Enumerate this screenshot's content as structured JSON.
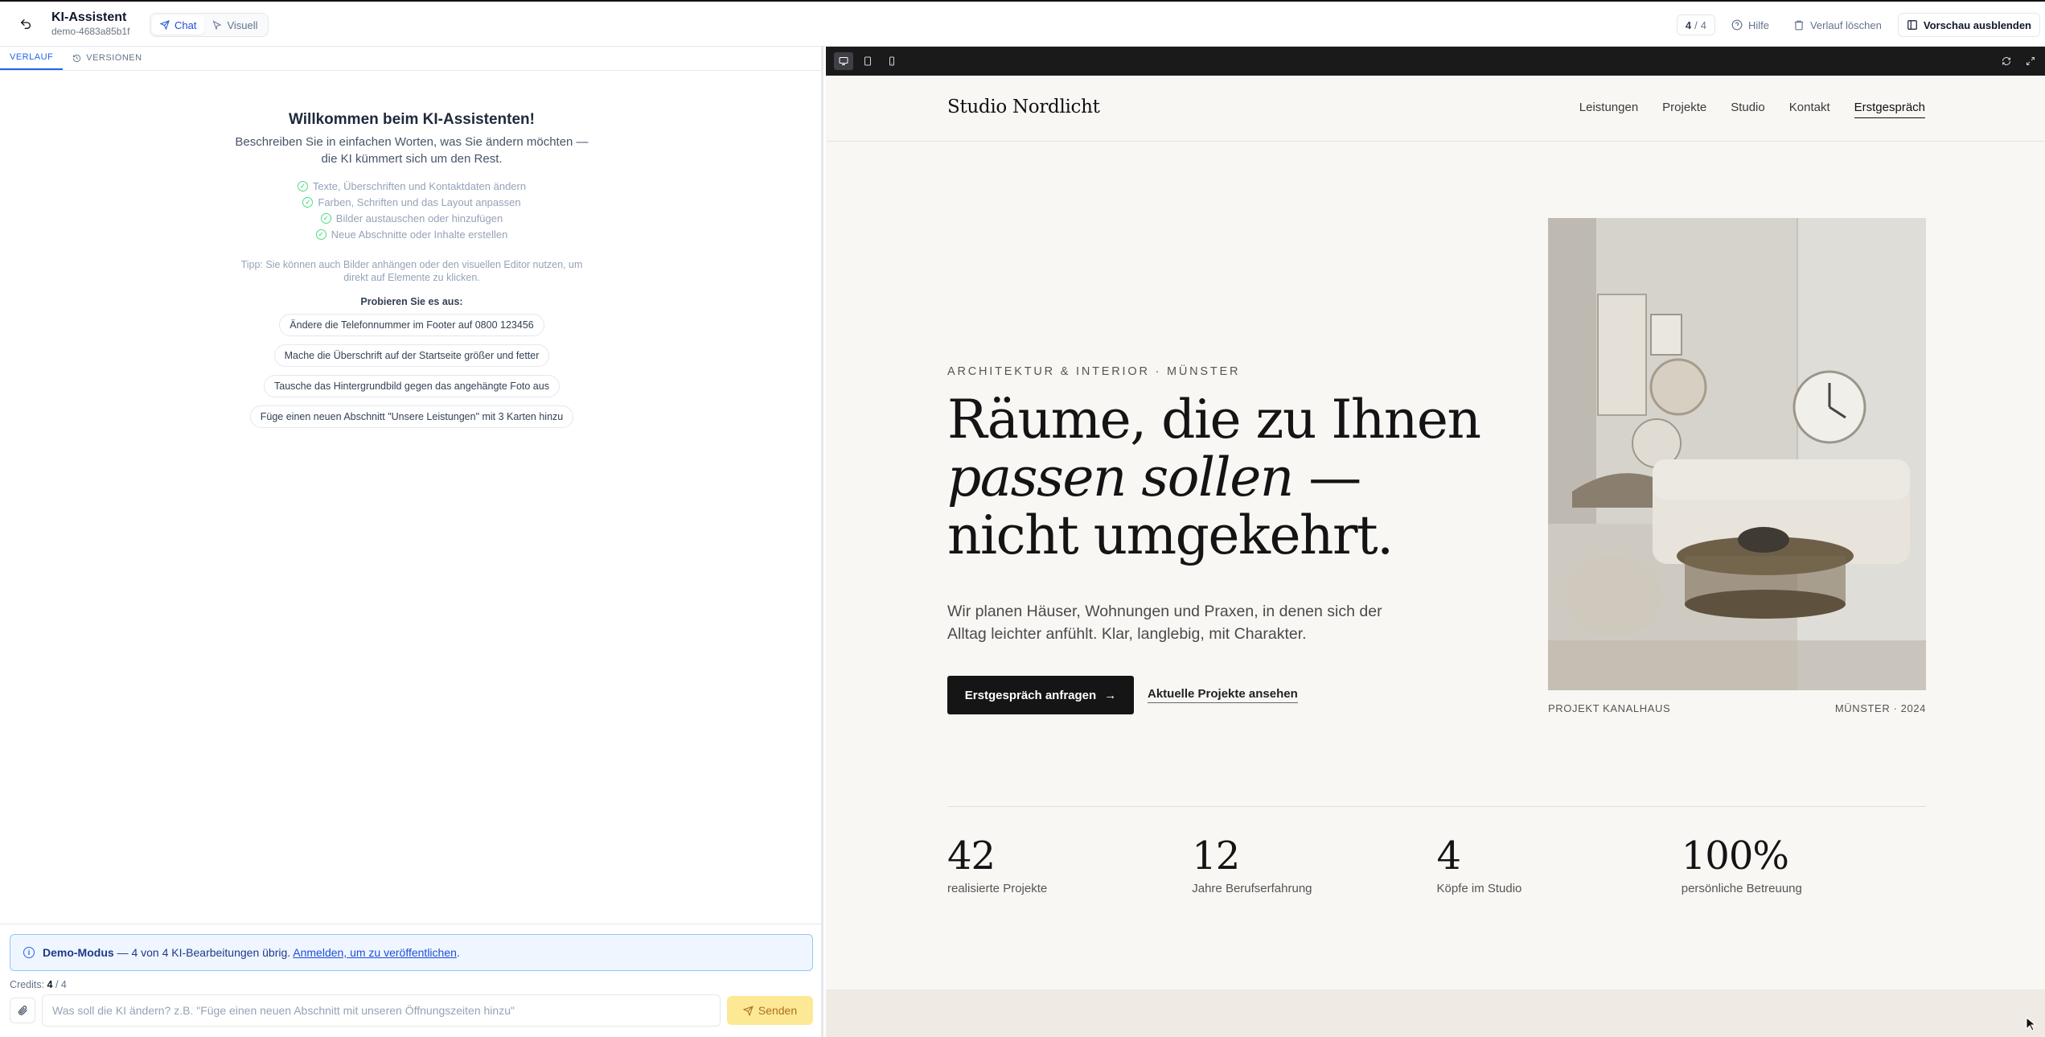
{
  "topbar": {
    "title": "KI-Assistent",
    "subtitle": "demo-4683a85b1f",
    "modes": [
      {
        "label": "Chat",
        "icon": "send-icon",
        "active": true
      },
      {
        "label": "Visuell",
        "icon": "cursor-icon",
        "active": false
      }
    ],
    "credits": {
      "used": "4",
      "sep": "/",
      "total": "4"
    },
    "help_label": "Hilfe",
    "clear_label": "Verlauf löschen",
    "hide_preview_label": "Vorschau ausblenden"
  },
  "left": {
    "tabs": [
      {
        "label": "VERLAUF",
        "active": true
      },
      {
        "label": "VERSIONEN",
        "icon": "history-icon",
        "active": false
      }
    ],
    "welcome": {
      "title": "Willkommen beim KI-Assistenten!",
      "lead": "Beschreiben Sie in einfachen Worten, was Sie ändern möchten — die KI kümmert sich um den Rest.",
      "features": [
        "Texte, Überschriften und Kontaktdaten ändern",
        "Farben, Schriften und das Layout anpassen",
        "Bilder austauschen oder hinzufügen",
        "Neue Abschnitte oder Inhalte erstellen"
      ],
      "tip": "Tipp: Sie können auch Bilder anhängen oder den visuellen Editor nutzen, um direkt auf Elemente zu klicken.",
      "try_label": "Probieren Sie es aus:",
      "suggestions": [
        "Ändere die Telefonnummer im Footer auf 0800 123456",
        "Mache die Überschrift auf der Startseite größer und fetter",
        "Tausche das Hintergrundbild gegen das angehängte Foto aus",
        "Füge einen neuen Abschnitt \"Unsere Leistungen\" mit 3 Karten hinzu"
      ]
    },
    "demo": {
      "strong": "Demo-Modus",
      "text": " — 4 von 4 KI-Bearbeitungen übrig. ",
      "link": "Anmelden, um zu veröffentlichen",
      "end": "."
    },
    "credits": {
      "label": "Credits: ",
      "value": "4",
      "total": " / 4"
    },
    "composer": {
      "placeholder": "Was soll die KI ändern? z.B. \"Füge einen neuen Abschnitt mit unseren Öffnungszeiten hinzu\"",
      "send_label": "Senden"
    }
  },
  "preview": {
    "devices": [
      "desktop-icon",
      "tablet-icon",
      "mobile-icon"
    ],
    "site": {
      "logo": "Studio Nordlicht",
      "nav": [
        "Leistungen",
        "Projekte",
        "Studio",
        "Kontakt"
      ],
      "nav_cta": "Erstgespräch",
      "eyebrow": "ARCHITEKTUR & INTERIOR · MÜNSTER",
      "headline_1": "Räume, die zu Ihnen",
      "headline_2_italic": "passen sollen",
      "headline_2_rest": " —",
      "headline_3": "nicht umgekehrt.",
      "subcopy": "Wir planen Häuser, Wohnungen und Praxen, in denen sich der Alltag leichter anfühlt. Klar, langlebig, mit Charakter.",
      "primary_cta": "Erstgespräch anfragen",
      "secondary_cta": "Aktuelle Projekte ansehen",
      "caption_left": "PROJEKT KANALHAUS",
      "caption_right": "MÜNSTER · 2024",
      "stats": [
        {
          "number": "42",
          "label": "realisierte Projekte"
        },
        {
          "number": "12",
          "label": "Jahre Berufserfahrung"
        },
        {
          "number": "4",
          "label": "Köpfe im Studio"
        },
        {
          "number": "100%",
          "label": "persönliche Betreuung"
        }
      ]
    }
  }
}
